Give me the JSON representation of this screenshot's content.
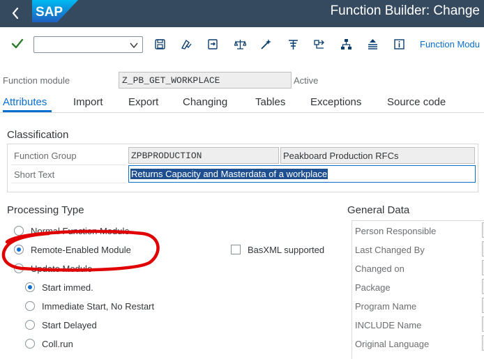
{
  "shell": {
    "logo_text": "SAP",
    "title": "Function Builder: Change"
  },
  "toolbar": {
    "command_value": "",
    "link_label": "Function Modu",
    "icons": [
      "checkmark-icon",
      "save-icon",
      "check-syntax-icon",
      "activate-icon",
      "where-used-icon",
      "test-icon",
      "display-object-list-icon",
      "navigate-icon",
      "hierarchy-icon",
      "pattern-icon",
      "info-icon"
    ]
  },
  "header": {
    "fm_label": "Function module",
    "fm_value": "Z_PB_GET_WORKPLACE",
    "status": "Active"
  },
  "tabs": [
    {
      "label": "Attributes",
      "active": true
    },
    {
      "label": "Import",
      "active": false
    },
    {
      "label": "Export",
      "active": false
    },
    {
      "label": "Changing",
      "active": false
    },
    {
      "label": "Tables",
      "active": false
    },
    {
      "label": "Exceptions",
      "active": false
    },
    {
      "label": "Source code",
      "active": false
    }
  ],
  "classification": {
    "title": "Classification",
    "function_group_label": "Function Group",
    "function_group_value": "ZPBPRODUCTION",
    "function_group_desc": "Peakboard Production RFCs",
    "short_text_label": "Short Text",
    "short_text_value": "Returns Capacity and Masterdata of a workplace"
  },
  "processing_type": {
    "title": "Processing Type",
    "options": [
      {
        "label": "Normal Function Module",
        "selected": false
      },
      {
        "label": "Remote-Enabled Module",
        "selected": true
      },
      {
        "label": "Update Module",
        "selected": false
      }
    ],
    "basxml_label": "BasXML supported",
    "basxml_checked": false,
    "update_options": [
      {
        "label": "Start immed.",
        "selected": true
      },
      {
        "label": "Immediate Start, No Restart",
        "selected": false
      },
      {
        "label": "Start Delayed",
        "selected": false
      },
      {
        "label": "Coll.run",
        "selected": false
      }
    ]
  },
  "general_data": {
    "title": "General Data",
    "rows": [
      "Person Responsible",
      "Last Changed By",
      "Changed on",
      "Package",
      "Program Name",
      "INCLUDE Name",
      "Original Language"
    ]
  },
  "colors": {
    "shell": "#354a5f",
    "accent": "#0a6ed1",
    "annotation": "#e00000"
  }
}
